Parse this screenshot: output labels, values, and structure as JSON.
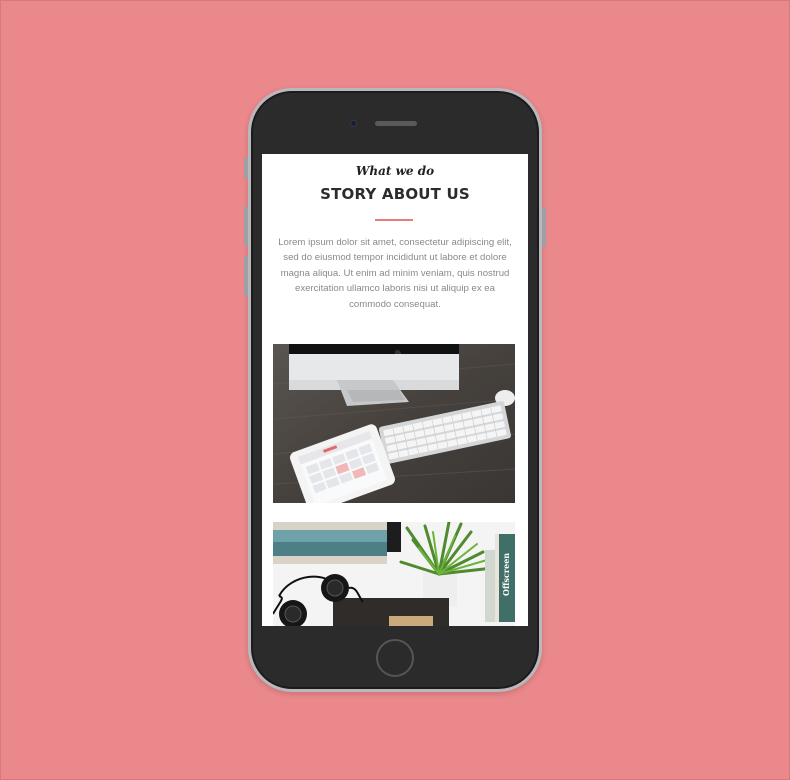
{
  "section": {
    "kicker": "What we do",
    "title": "STORY ABOUT US",
    "body": "Lorem ipsum dolor sit amet, consectetur adipiscing elit, sed do eiusmod tempor incididunt ut labore et dolore magna aliqua. Ut enim ad minim veniam, quis nostrud exercitation ullamco laboris nisi ut aliquip ex ea commodo consequat."
  },
  "photos": [
    {
      "name": "desk-workspace-photo",
      "icon": "imac-keyboard-tablet-image"
    },
    {
      "name": "headphones-plant-photo",
      "icon": "headphones-plant-book-image",
      "book_spine_text": "Offscreen"
    }
  ],
  "colors": {
    "background": "#ea888b",
    "accent": "#e77c7f",
    "phone_body": "#2b2b2b",
    "text_muted": "#8a8a8a"
  }
}
